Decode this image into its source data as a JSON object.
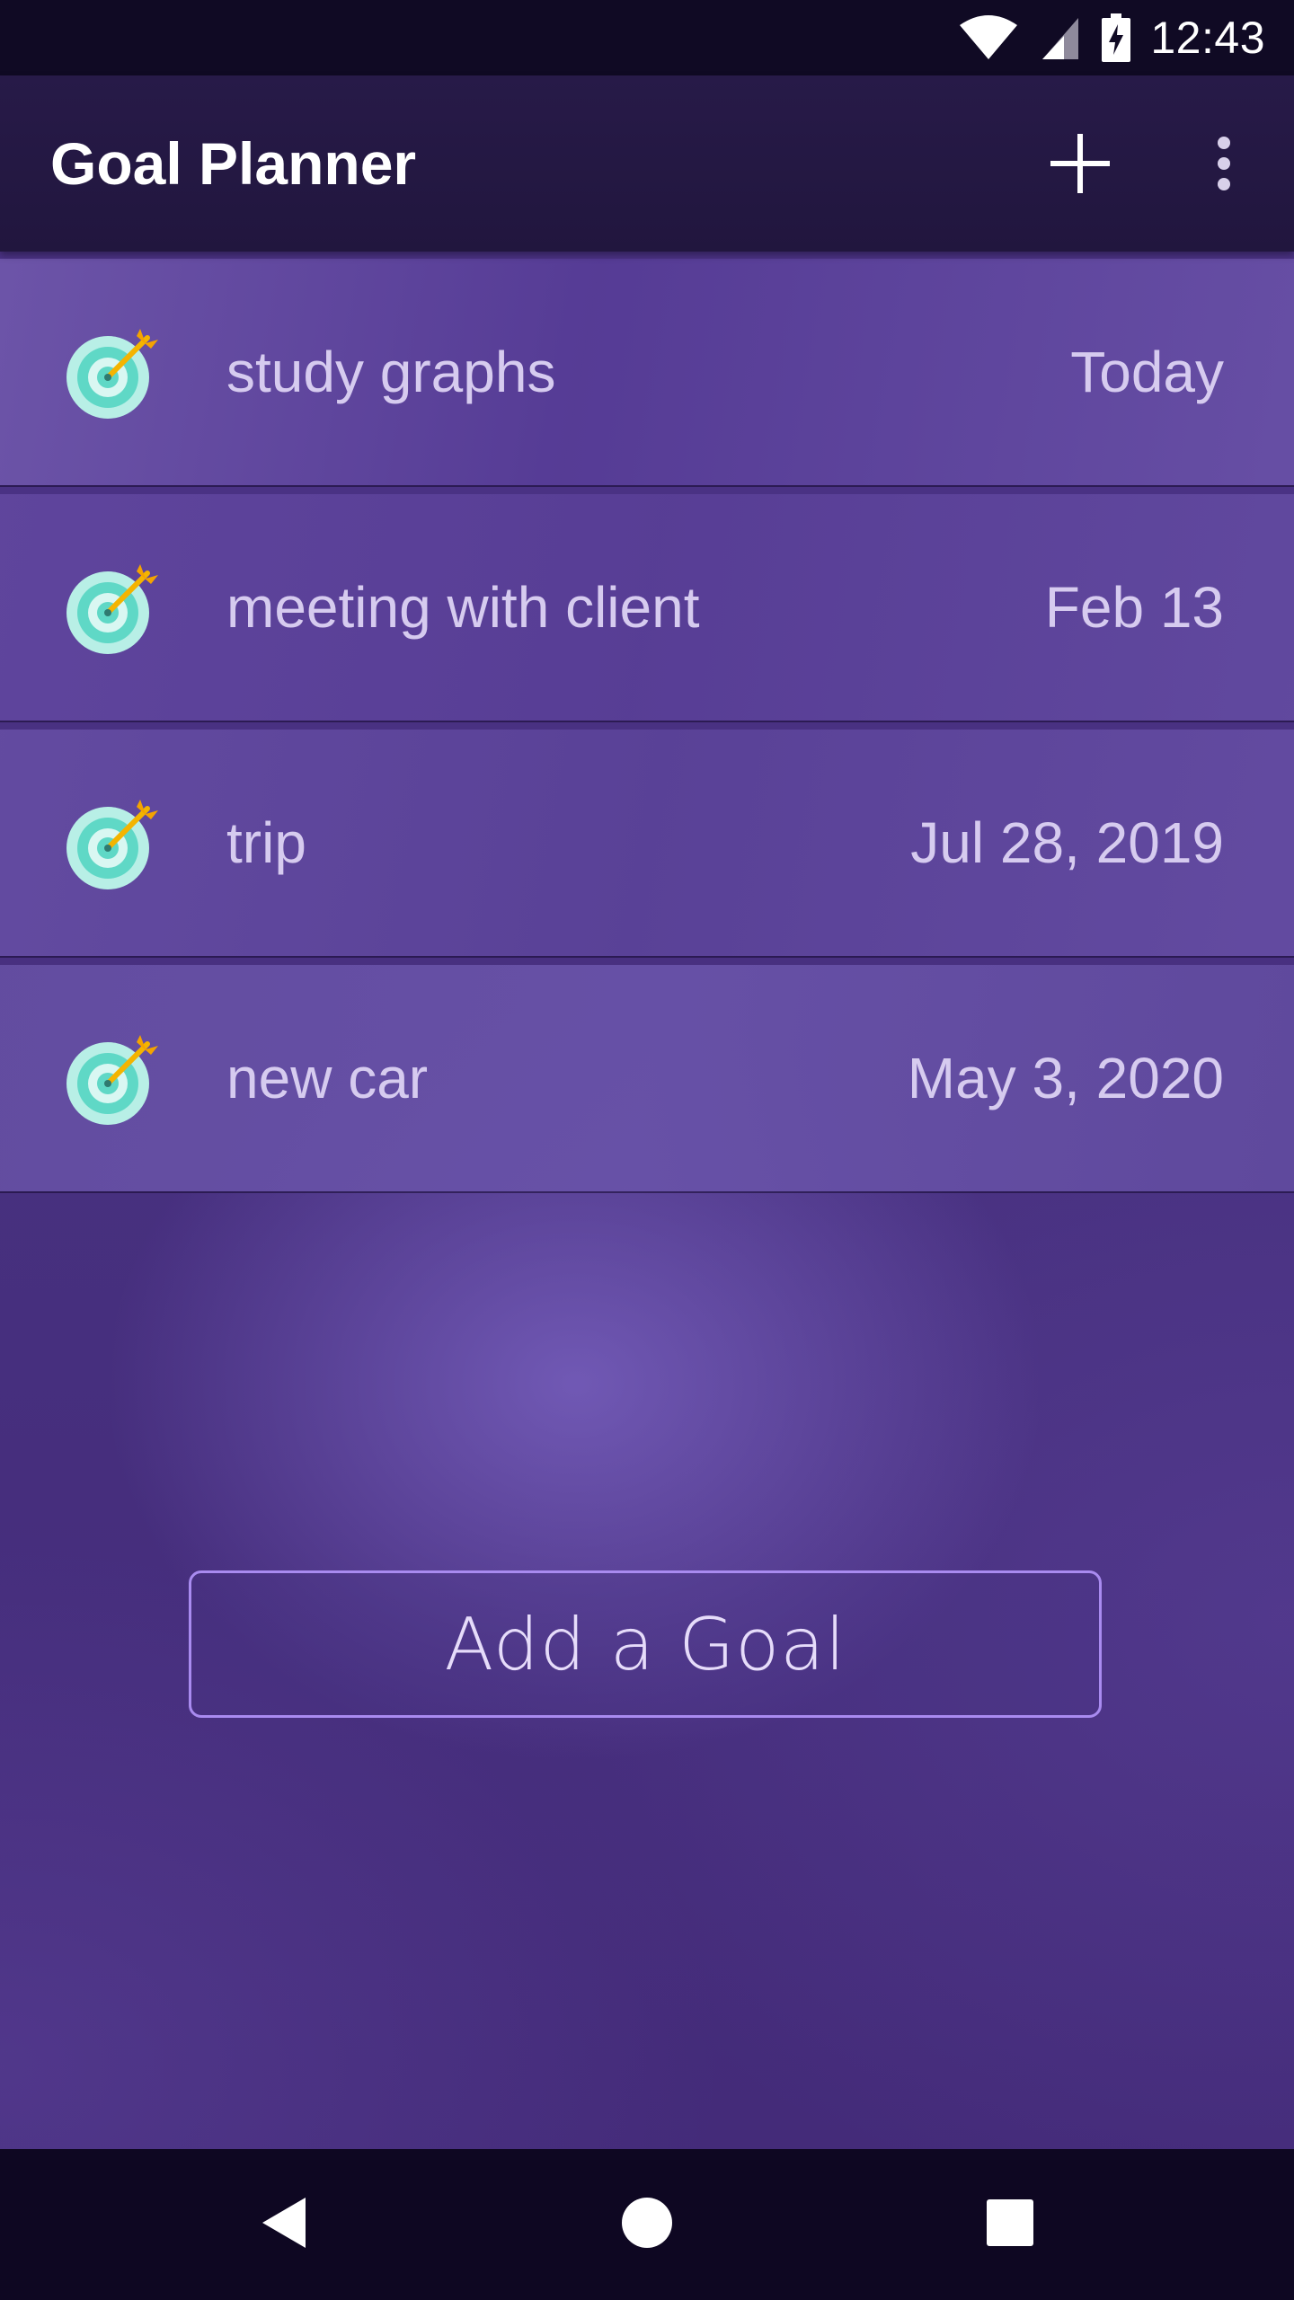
{
  "status_bar": {
    "time": "12:43",
    "icons": [
      "wifi-icon",
      "cell-signal-icon",
      "battery-charging-icon"
    ]
  },
  "app_bar": {
    "title": "Goal Planner",
    "actions": [
      "add-icon",
      "overflow-menu-icon"
    ]
  },
  "goals": [
    {
      "title": "study graphs",
      "date": "Today",
      "icon": "target-icon"
    },
    {
      "title": "meeting with client",
      "date": "Feb 13",
      "icon": "target-icon"
    },
    {
      "title": "trip",
      "date": "Jul 28, 2019",
      "icon": "target-icon"
    },
    {
      "title": "new car",
      "date": "May 3, 2020",
      "icon": "target-icon"
    }
  ],
  "add_goal_button": {
    "label": "Add a Goal"
  },
  "nav_bar": {
    "buttons": [
      "back-icon",
      "home-icon",
      "recents-icon"
    ]
  },
  "colors": {
    "status_bar_bg": "#100a24",
    "app_bar_bg": "#21163e",
    "background_purple": "#47307f",
    "item_text": "#d6cbef",
    "button_border": "#a98bf0",
    "target_teal": "#5fd8c6",
    "dart_gold": "#f4b400"
  }
}
